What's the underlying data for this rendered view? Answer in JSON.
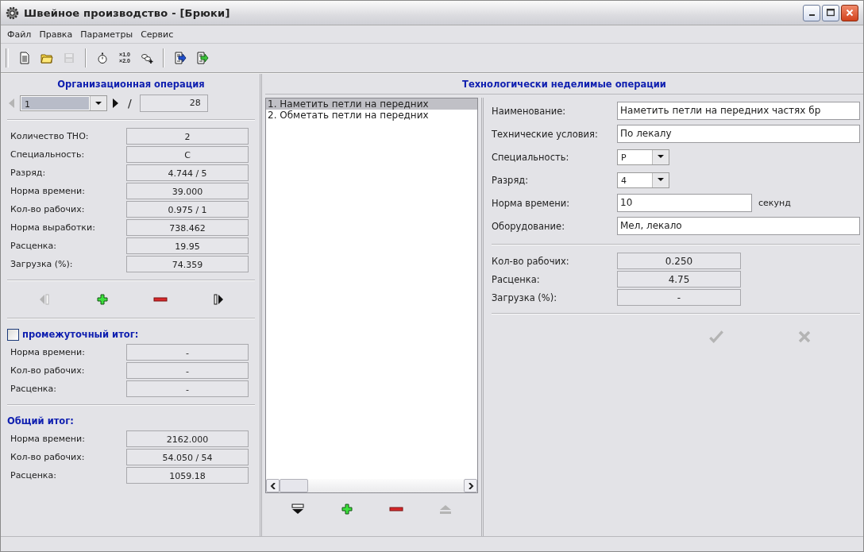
{
  "window": {
    "title": "Швейное производство - [Брюки]"
  },
  "menu": [
    {
      "label": "Файл"
    },
    {
      "label": "Правка"
    },
    {
      "label": "Параметры"
    },
    {
      "label": "Сервис"
    }
  ],
  "toolbar": [
    {
      "kind": "new",
      "disabled": false
    },
    {
      "kind": "open",
      "disabled": false
    },
    {
      "kind": "save",
      "disabled": true
    },
    {
      "kind": "separator"
    },
    {
      "kind": "stopwatch",
      "disabled": false
    },
    {
      "kind": "scale",
      "lines": [
        "×1.0",
        "×2.0"
      ],
      "disabled": false
    },
    {
      "kind": "glasses",
      "disabled": false
    },
    {
      "kind": "separator"
    },
    {
      "kind": "export",
      "disabled": false
    },
    {
      "kind": "import",
      "disabled": false
    }
  ],
  "organization": {
    "title": "Организационная операция",
    "nav": {
      "value": "1",
      "separator": "/",
      "total": "28",
      "prev_disabled": true,
      "next_disabled": false
    },
    "stats": [
      {
        "label": "Количество ТНО:",
        "value": "2"
      },
      {
        "label": "Специальность:",
        "value": "С"
      },
      {
        "label": "Разряд:",
        "value": "4.744 / 5"
      },
      {
        "label": "Норма времени:",
        "value": "39.000"
      },
      {
        "label": "Кол-во рабочих:",
        "value": "0.975 / 1"
      },
      {
        "label": "Норма выработки:",
        "value": "738.462"
      },
      {
        "label": "Расценка:",
        "value": "19.95"
      },
      {
        "label": "Загрузка (%):",
        "value": "74.359"
      }
    ],
    "actions": [
      {
        "kind": "first",
        "disabled": true
      },
      {
        "kind": "add",
        "disabled": false
      },
      {
        "kind": "remove",
        "disabled": false
      },
      {
        "kind": "last",
        "disabled": false
      }
    ],
    "subtotal": {
      "label": "промежуточный итог:",
      "checked": false,
      "rows": [
        {
          "label": "Норма времени:",
          "value": "-"
        },
        {
          "label": "Кол-во рабочих:",
          "value": "-"
        },
        {
          "label": "Расценка:",
          "value": "-"
        }
      ]
    },
    "total": {
      "title": "Общий итог:",
      "rows": [
        {
          "label": "Норма времени:",
          "value": "2162.000"
        },
        {
          "label": "Кол-во рабочих:",
          "value": "54.050 / 54"
        },
        {
          "label": "Расценка:",
          "value": "1059.18"
        }
      ]
    }
  },
  "operations": {
    "title": "Технологически неделимые операции",
    "items": [
      {
        "text": "1. Наметить петли на передних",
        "selected": true
      },
      {
        "text": "2. Обметать петли на передних",
        "selected": false
      }
    ],
    "actions": [
      {
        "kind": "move_down",
        "disabled": false
      },
      {
        "kind": "add",
        "disabled": false
      },
      {
        "kind": "remove",
        "disabled": false
      },
      {
        "kind": "move_up",
        "disabled": true
      }
    ],
    "fields": [
      {
        "kind": "text",
        "label": "Наименование:",
        "value": "Наметить петли на передних частях бр"
      },
      {
        "kind": "text",
        "label": "Технические условия:",
        "value": "По лекалу"
      },
      {
        "kind": "combo",
        "label": "Специальность:",
        "value": "Р"
      },
      {
        "kind": "combo",
        "label": "Разряд:",
        "value": "4"
      },
      {
        "kind": "short",
        "label": "Норма времени:",
        "value": "10",
        "unit": "секунд"
      },
      {
        "kind": "text",
        "label": "Оборудование:",
        "value": "Мел, лекало"
      }
    ],
    "stats": [
      {
        "label": "Кол-во рабочих:",
        "value": "0.250"
      },
      {
        "label": "Расценка:",
        "value": "4.75"
      },
      {
        "label": "Загрузка (%):",
        "value": "-"
      }
    ],
    "confirm_disabled": true,
    "cancel_disabled": true
  }
}
